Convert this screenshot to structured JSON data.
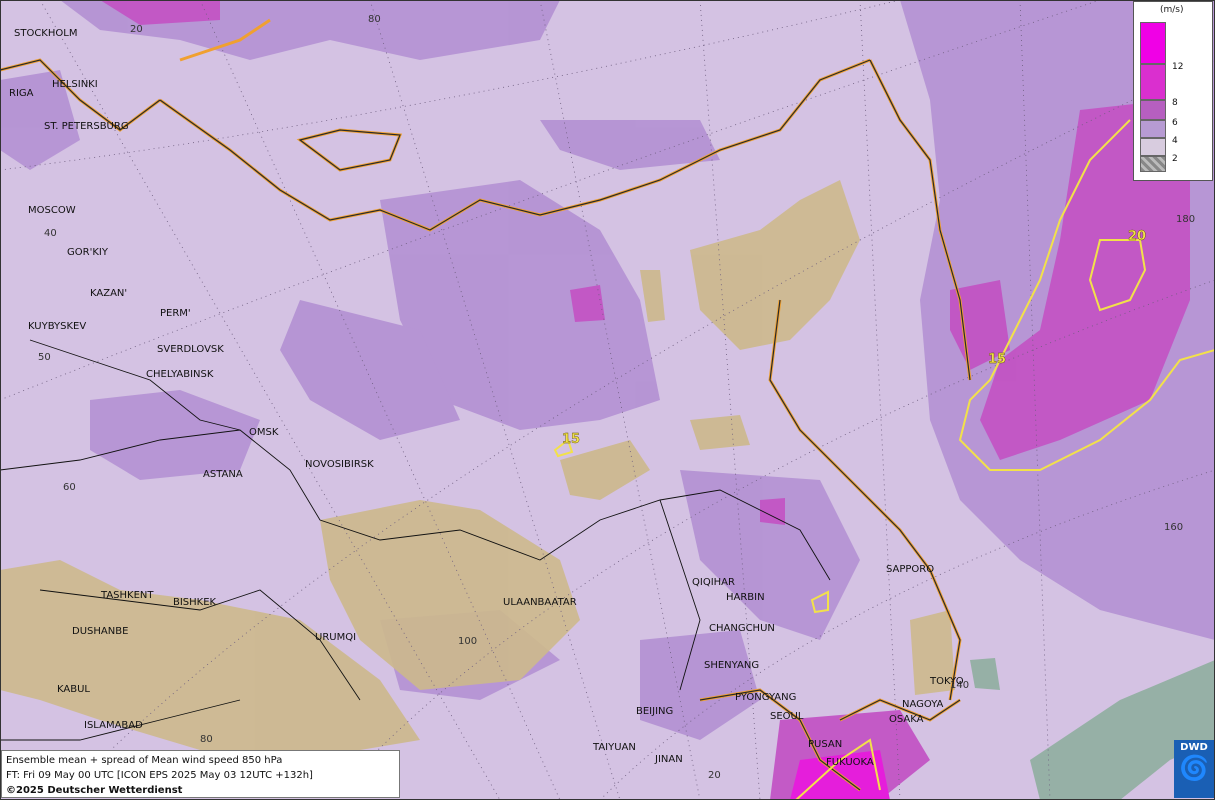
{
  "legend": {
    "unit": "(m/s)",
    "levels": [
      {
        "label": "12",
        "color": "#f000e6"
      },
      {
        "label": "8",
        "color": "#da2fcf"
      },
      {
        "label": "6",
        "color": "#b65fc0"
      },
      {
        "label": "4",
        "color": "#b79bd3"
      },
      {
        "label": "2",
        "color": "#d8ccdf"
      },
      {
        "label": "",
        "color": "#9a9a9a"
      }
    ]
  },
  "info": {
    "line1": "Ensemble mean + spread of Mean wind speed 850 hPa",
    "line2": "FT: Fri 09 May 00 UTC [ICON EPS 2025 May 03 12UTC +132h]",
    "copyright": "©2025 Deutscher Wetterdienst"
  },
  "logo": {
    "text": "DWD",
    "icon": "spiral-icon"
  },
  "cities": [
    "STOCKHOLM",
    "HELSINKI",
    "RIGA",
    "ST. PETERSBURG",
    "MOSCOW",
    "GOR'KIY",
    "KAZAN'",
    "PERM'",
    "KUYBYSKEV",
    "SVERDLOVSK",
    "CHELYABINSK",
    "OMSK",
    "NOVOSIBIRSK",
    "ASTANA",
    "TASHKENT",
    "BISHKEK",
    "DUSHANBE",
    "URUMQI",
    "ULAANBAATAR",
    "KABUL",
    "ISLAMABAD",
    "QIQIHAR",
    "HARBIN",
    "CHANGCHUN",
    "SHENYANG",
    "PYONGYANG",
    "SEOUL",
    "BEIJING",
    "TAIYUAN",
    "JINAN",
    "PUSAN",
    "FUKUOKA",
    "SAPPORO",
    "TOKYO",
    "NAGOYA",
    "OSAKA"
  ],
  "grid_labels": [
    "20",
    "80",
    "40",
    "50",
    "60",
    "100",
    "80",
    "20",
    "180",
    "160",
    "140"
  ],
  "contour_labels": [
    "15",
    "15",
    "20"
  ]
}
